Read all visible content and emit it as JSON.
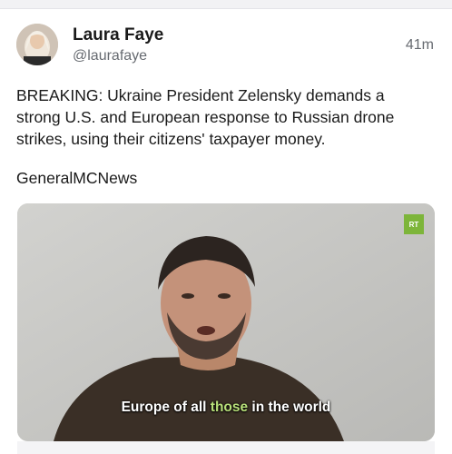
{
  "post": {
    "author": {
      "display_name": "Laura Faye",
      "handle": "@laurafaye"
    },
    "timestamp": "41m",
    "text_lines": [
      "BREAKING: Ukraine President Zelensky demands a",
      "strong U.S. and European response to Russian drone",
      "strikes, using their citizens' taxpayer money."
    ],
    "source": "GeneralMCNews",
    "media": {
      "type": "video",
      "channel_badge": "RT",
      "subtitle_before": "Europe of all ",
      "subtitle_highlight": "those",
      "subtitle_after": " in the world"
    }
  },
  "colors": {
    "subtitle_highlight": "#b8e07a",
    "badge": "#7db53a"
  }
}
